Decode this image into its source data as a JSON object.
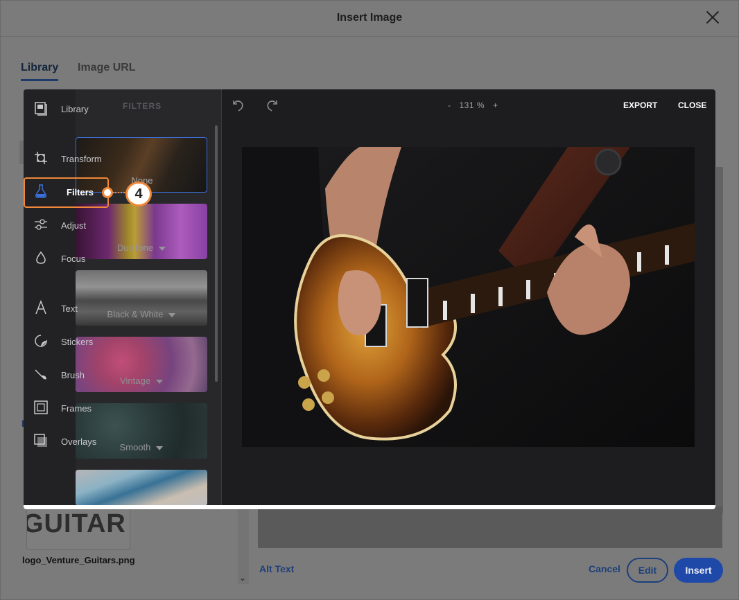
{
  "dialog": {
    "title": "Insert Image",
    "tabs": [
      {
        "label": "Library"
      },
      {
        "label": "Image URL"
      }
    ],
    "left_letter": "I",
    "thumbnail_text": "GUITAR",
    "filename": "logo_Venture_Guitars.png",
    "alt_text_label": "Alt Text",
    "cancel_label": "Cancel",
    "edit_label": "Edit",
    "insert_label": "Insert"
  },
  "editor": {
    "rail": [
      {
        "label": "Library",
        "icon": "library-icon"
      },
      {
        "label": "Transform",
        "icon": "transform-icon"
      },
      {
        "label": "Filters",
        "icon": "filters-flask-icon"
      },
      {
        "label": "Adjust",
        "icon": "adjust-sliders-icon"
      },
      {
        "label": "Focus",
        "icon": "focus-drop-icon"
      },
      {
        "label": "Text",
        "icon": "text-icon"
      },
      {
        "label": "Stickers",
        "icon": "stickers-icon"
      },
      {
        "label": "Brush",
        "icon": "brush-icon"
      },
      {
        "label": "Frames",
        "icon": "frames-icon"
      },
      {
        "label": "Overlays",
        "icon": "overlays-icon"
      }
    ],
    "panel_title": "FILTERS",
    "filter_cards": [
      {
        "label": "None"
      },
      {
        "label": "DuoTone"
      },
      {
        "label": "Black & White"
      },
      {
        "label": "Vintage"
      },
      {
        "label": "Smooth"
      }
    ],
    "zoom": {
      "minus": "-",
      "value": "131 %",
      "plus": "+"
    },
    "export_label": "EXPORT",
    "close_label": "CLOSE"
  },
  "callout": {
    "number": "4",
    "color": "#f0883a"
  },
  "colors": {
    "accent_blue": "#1f49a8",
    "link_blue": "#1d3f7a",
    "selected_outline": "#3b6fd9"
  }
}
